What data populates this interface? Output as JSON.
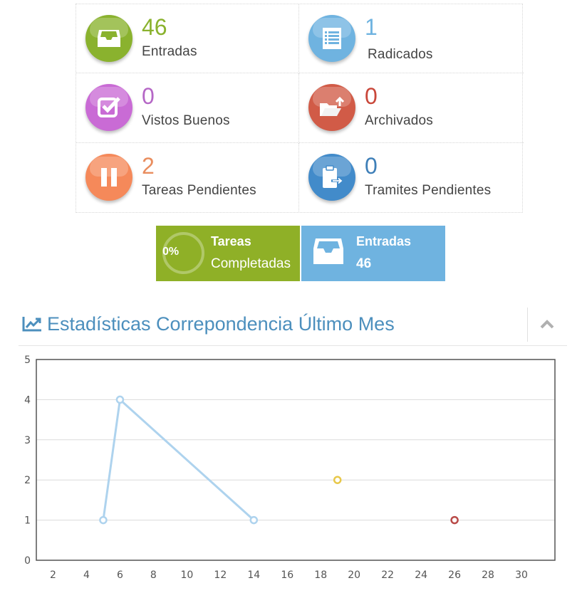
{
  "stats": [
    {
      "value": "46",
      "label": "Entradas",
      "color": "#87b87f",
      "num_color": "#8ab22e",
      "icon": "inbox-icon"
    },
    {
      "value": "1",
      "label": "Radicados",
      "color": "#6fb3e0",
      "num_color": "#6fb3e0",
      "icon": "list-icon"
    },
    {
      "value": "0",
      "label": "Vistos Buenos",
      "color": "#c96bd5",
      "num_color": "#b567c6",
      "icon": "check-square-icon"
    },
    {
      "value": "0",
      "label": "Archivados",
      "color": "#d15b47",
      "num_color": "#c9473a",
      "icon": "folder-upload-icon"
    },
    {
      "value": "2",
      "label": "Tareas Pendientes",
      "color": "#f5895a",
      "num_color": "#e98d5e",
      "icon": "pause-icon"
    },
    {
      "value": "0",
      "label": "Tramites Pendientes",
      "color": "#428bca",
      "num_color": "#3e7fb8",
      "icon": "clipboard-arrow-icon"
    }
  ],
  "tiles": {
    "completed": {
      "percent_label": "0%",
      "title": "Tareas",
      "subtitle": "Completadas",
      "color": "#8fb027",
      "percent": 0
    },
    "entradas": {
      "title": "Entradas",
      "value": "46",
      "color": "#6fb3e0",
      "icon": "inbox-icon"
    }
  },
  "widget": {
    "title": "Estadísticas Correpondencia Último Mes",
    "icon": "line-chart-icon",
    "collapse_icon": "chevron-up-icon"
  },
  "chart_data": {
    "type": "line",
    "xlim": [
      1,
      32
    ],
    "ylim": [
      0,
      5
    ],
    "x_ticks": [
      2,
      4,
      6,
      8,
      10,
      12,
      14,
      16,
      18,
      20,
      22,
      24,
      26,
      28,
      30
    ],
    "y_ticks": [
      0,
      1,
      2,
      3,
      4,
      5
    ],
    "grid": true,
    "series": [
      {
        "color": "#aed3ee",
        "points": [
          [
            5,
            1
          ],
          [
            6,
            4
          ],
          [
            14,
            1
          ]
        ]
      },
      {
        "color": "#e8c84a",
        "points": [
          [
            19,
            2
          ]
        ]
      },
      {
        "color": "#b94a48",
        "points": [
          [
            26,
            1
          ]
        ]
      }
    ]
  }
}
